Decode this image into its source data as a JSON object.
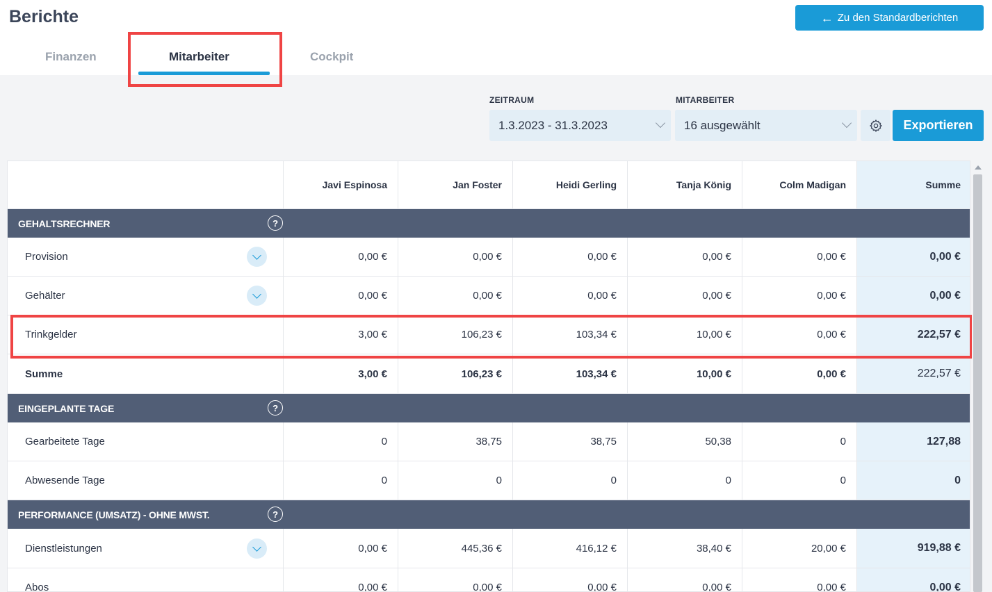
{
  "header": {
    "title": "Berichte",
    "back_button": "Zu den Standardberichten",
    "back_icon": "arrow-left-icon"
  },
  "tabs": [
    {
      "label": "Finanzen",
      "active": false
    },
    {
      "label": "Mitarbeiter",
      "active": true
    },
    {
      "label": "Cockpit",
      "active": false
    }
  ],
  "filters": {
    "zeitraum_label": "ZEITRAUM",
    "zeitraum_value": "1.3.2023 - 31.3.2023",
    "mitarbeiter_label": "MITARBEITER",
    "mitarbeiter_value": "16 ausgewählt",
    "export_button": "Exportieren"
  },
  "table": {
    "columns": [
      "",
      "Javi Espinosa",
      "Jan Foster",
      "Heidi Gerling",
      "Tanja König",
      "Colm Madigan",
      "Summe"
    ],
    "sections": [
      {
        "title": "GEHALTSRECHNER",
        "rows": [
          {
            "label": "Provision",
            "values": [
              "0,00 €",
              "0,00 €",
              "0,00 €",
              "0,00 €",
              "0,00 €",
              "0,00 €"
            ],
            "expandable": true
          },
          {
            "label": "Gehälter",
            "values": [
              "0,00 €",
              "0,00 €",
              "0,00 €",
              "0,00 €",
              "0,00 €",
              "0,00 €"
            ],
            "expandable": true
          },
          {
            "label": "Trinkgelder",
            "values": [
              "3,00 €",
              "106,23 €",
              "103,34 €",
              "10,00 €",
              "0,00 €",
              "222,57 €"
            ],
            "expandable": false
          },
          {
            "label": "Summe",
            "values": [
              "3,00 €",
              "106,23 €",
              "103,34 €",
              "10,00 €",
              "0,00 €",
              "222,57 €"
            ],
            "expandable": false
          }
        ]
      },
      {
        "title": "EINGEPLANTE TAGE",
        "rows": [
          {
            "label": "Gearbeitete Tage",
            "values": [
              "0",
              "38,75",
              "38,75",
              "50,38",
              "0",
              "127,88"
            ],
            "expandable": false
          },
          {
            "label": "Abwesende Tage",
            "values": [
              "0",
              "0",
              "0",
              "0",
              "0",
              "0"
            ],
            "expandable": false
          }
        ]
      },
      {
        "title": "PERFORMANCE (UMSATZ) - OHNE MWST.",
        "rows": [
          {
            "label": "Dienstleistungen",
            "values": [
              "0,00 €",
              "445,36 €",
              "416,12 €",
              "38,40 €",
              "20,00 €",
              "919,88 €"
            ],
            "expandable": true
          },
          {
            "label": "Abos",
            "values": [
              "0,00 €",
              "0,00 €",
              "0,00 €",
              "0,00 €",
              "0,00 €",
              "0,00 €"
            ],
            "expandable": false
          }
        ]
      }
    ]
  },
  "colors": {
    "accent": "#1a9bd7",
    "section_header": "#515e76",
    "sum_column": "#e6f2fa",
    "highlight": "#ef4444"
  }
}
